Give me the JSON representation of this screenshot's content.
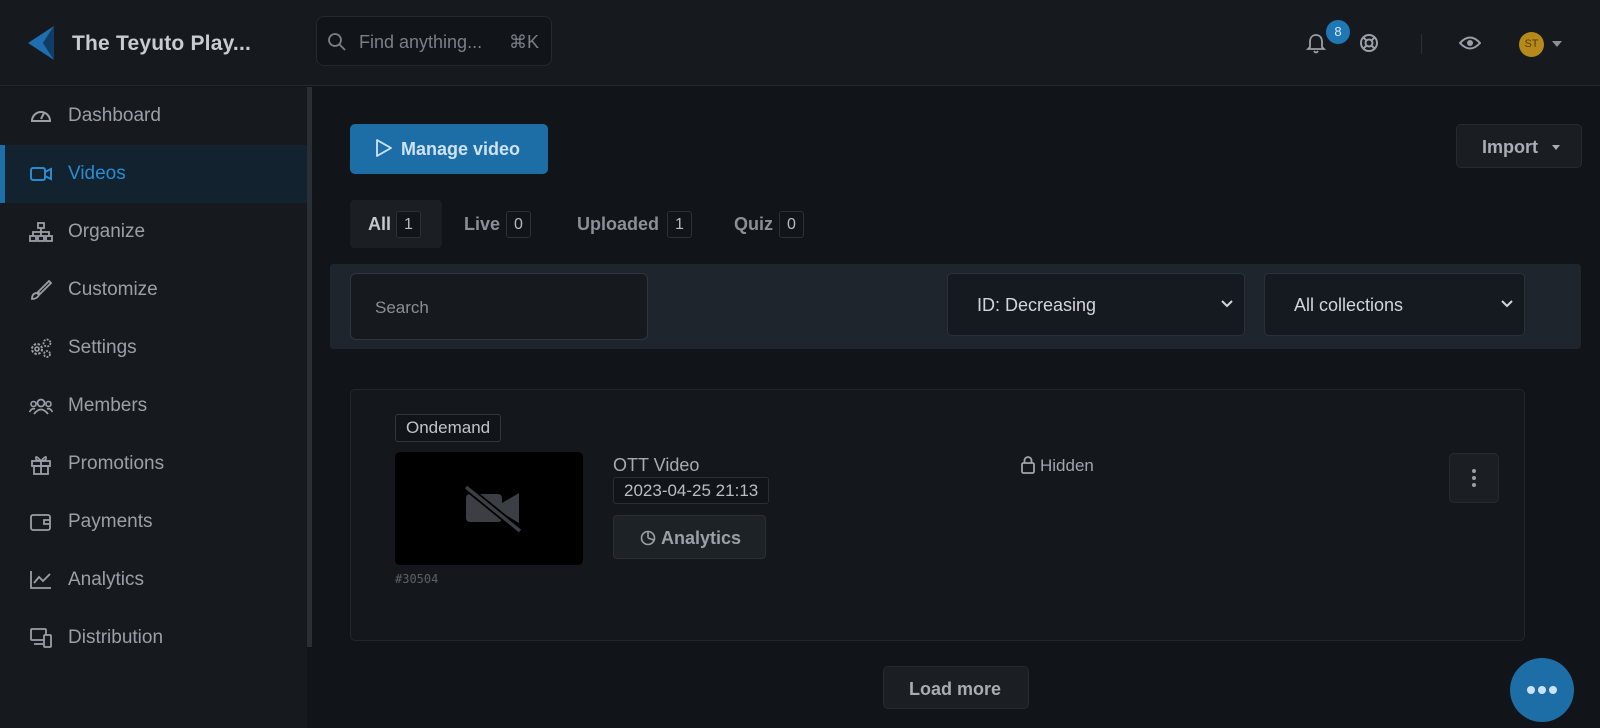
{
  "header": {
    "brand": "The Teyuto Play...",
    "search_placeholder": "Find anything...",
    "search_shortcut": "⌘K",
    "notification_count": "8",
    "avatar_initials": "ST"
  },
  "sidebar": {
    "items": [
      {
        "label": "Dashboard",
        "icon": "gauge-icon"
      },
      {
        "label": "Videos",
        "icon": "video-camera-icon",
        "active": true
      },
      {
        "label": "Organize",
        "icon": "sitemap-icon"
      },
      {
        "label": "Customize",
        "icon": "brush-icon"
      },
      {
        "label": "Settings",
        "icon": "gears-icon"
      },
      {
        "label": "Members",
        "icon": "users-icon"
      },
      {
        "label": "Promotions",
        "icon": "gift-icon"
      },
      {
        "label": "Payments",
        "icon": "wallet-icon"
      },
      {
        "label": "Analytics",
        "icon": "chart-line-icon"
      },
      {
        "label": "Distribution",
        "icon": "devices-icon"
      }
    ]
  },
  "main": {
    "manage_video_label": "Manage video",
    "import_label": "Import",
    "tabs": [
      {
        "label": "All",
        "count": "1",
        "active": true
      },
      {
        "label": "Live",
        "count": "0"
      },
      {
        "label": "Uploaded",
        "count": "1"
      },
      {
        "label": "Quiz",
        "count": "0"
      }
    ],
    "filters": {
      "search_placeholder": "Search",
      "sort_value": "ID: Decreasing",
      "collection_value": "All collections"
    },
    "videos": [
      {
        "type_tag": "Ondemand",
        "id": "#30504",
        "title": "OTT Video",
        "date": "2023-04-25 21:13",
        "analytics_label": "Analytics",
        "visibility": "Hidden"
      }
    ],
    "load_more_label": "Load more"
  },
  "colors": {
    "accent": "#1d6ea6",
    "active_nav_text": "#2c8bd0",
    "background": "#111418",
    "panel": "#161a1e"
  }
}
